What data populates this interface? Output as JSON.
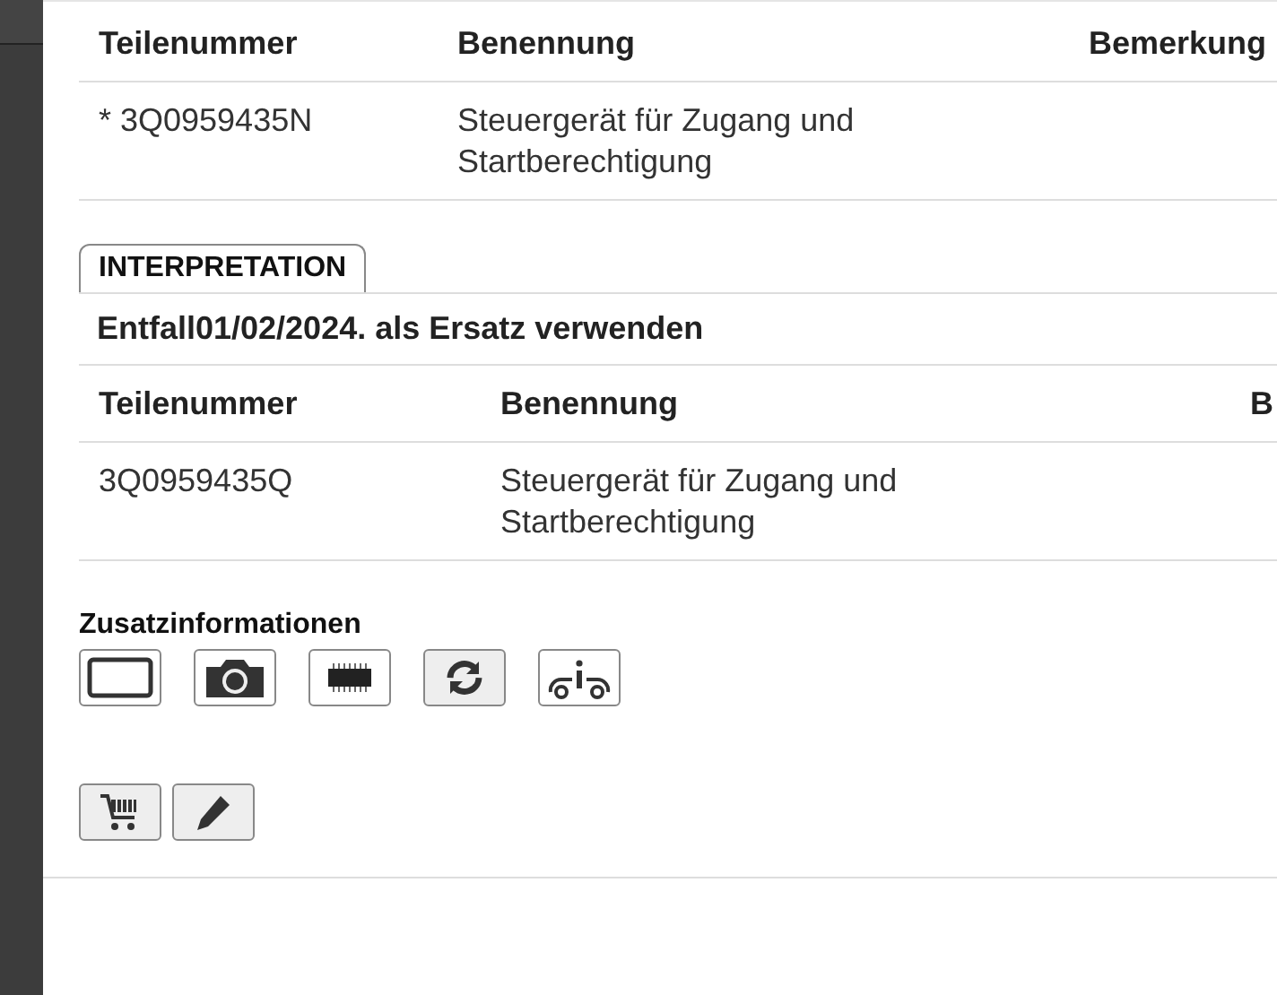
{
  "parts_table": {
    "columns": [
      "Teilenummer",
      "Benennung",
      "Bemerkung"
    ],
    "rows": [
      [
        "* 3Q0959435N",
        "Steuergerät für Zugang und Startberechtigung"
      ]
    ]
  },
  "interpretation": {
    "tab": "INTERPRETATION",
    "notice": "Entfall01/02/2024. als Ersatz verwenden",
    "table": {
      "columns": [
        "Teilenummer",
        "Benennung",
        "B"
      ],
      "rows": [
        [
          "3Q0959435Q",
          "Steuergerät für Zugang und Startberechtigung"
        ]
      ]
    }
  },
  "additional_info": {
    "title": "Zusatzinformationen",
    "buttons": [
      {
        "kind": "frame"
      },
      {
        "kind": "camera"
      },
      {
        "kind": "chip"
      },
      {
        "kind": "refresh"
      },
      {
        "kind": "info-car"
      }
    ]
  },
  "actions": [
    {
      "kind": "cart"
    },
    {
      "kind": "pencil"
    }
  ]
}
